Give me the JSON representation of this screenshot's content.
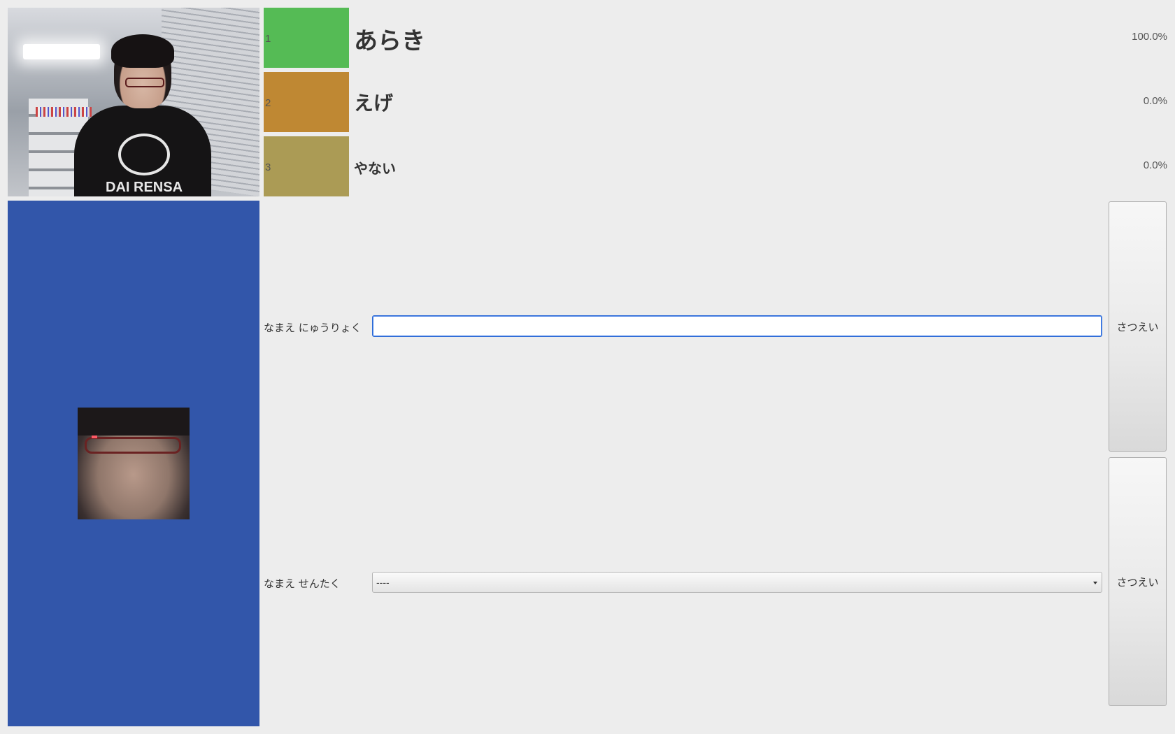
{
  "camera": {
    "feed_icon": "camera-feed",
    "hoodie_text": "DAI RENSA"
  },
  "ranking": [
    {
      "rank": "1",
      "name": "あらき",
      "percent": "100.0%",
      "color": "#55bb55"
    },
    {
      "rank": "2",
      "name": "えげ",
      "percent": "0.0%",
      "color": "#bf8833"
    },
    {
      "rank": "3",
      "name": "やない",
      "percent": "0.0%",
      "color": "#ab9b55"
    }
  ],
  "face_panel": {
    "background_color": "#3256aa"
  },
  "form": {
    "name_input_label": "なまえ にゅうりょく",
    "name_input_value": "",
    "name_select_label": "なまえ せんたく",
    "name_select_value": "----",
    "capture_button_label": "さつえい"
  }
}
